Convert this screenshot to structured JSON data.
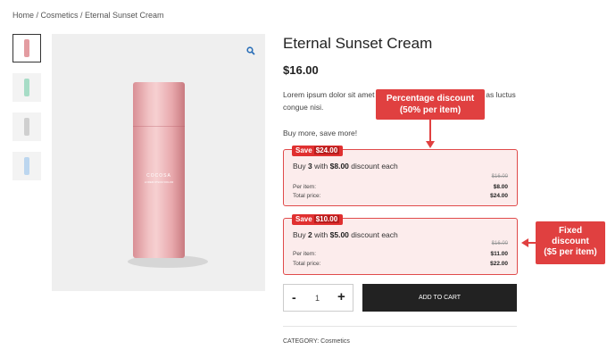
{
  "breadcrumb": "Home / Cosmetics / Eternal Sunset Cream",
  "product": {
    "title": "Eternal Sunset Cream",
    "price": "$16.00",
    "description_part1": "Lorem ipsum dolor sit amet",
    "description_part2": "as luctus",
    "description_line2": "congue nisi.",
    "buy_more": "Buy more, save more!",
    "bottle_brand": "COCOSA",
    "bottle_sub": "LOREM IPSUM DOLOR"
  },
  "thumbnails": [
    {
      "color": "#e39ca1"
    },
    {
      "color": "#a7dcc6"
    },
    {
      "color": "#cfcfcf"
    },
    {
      "color": "#bcd6ef"
    }
  ],
  "offers": [
    {
      "save_label": "Save",
      "save_amount": "$24.00",
      "offer_prefix": "Buy",
      "qty": "3",
      "with": "with",
      "discount": "$8.00",
      "suffix": "discount each",
      "original": "$16.00",
      "per_item_label": "Per item:",
      "per_item_value": "$8.00",
      "total_label": "Total price:",
      "total_value": "$24.00"
    },
    {
      "save_label": "Save",
      "save_amount": "$10.00",
      "offer_prefix": "Buy",
      "qty": "2",
      "with": "with",
      "discount": "$5.00",
      "suffix": "discount each",
      "original": "$16.00",
      "per_item_label": "Per item:",
      "per_item_value": "$11.00",
      "total_label": "Total price:",
      "total_value": "$22.00"
    }
  ],
  "callouts": {
    "percentage_line1": "Percentage discount",
    "percentage_line2": "(50% per item)",
    "fixed_line1": "Fixed",
    "fixed_line2": "discount",
    "fixed_line3": "($5 per item)"
  },
  "cart": {
    "minus": "-",
    "quantity": "1",
    "plus": "+",
    "add_to_cart": "ADD TO CART"
  },
  "category": "CATEGORY: Cosmetics",
  "colors": {
    "accent_red": "#e04040",
    "offer_bg": "#fcecec",
    "button_dark": "#222222"
  }
}
